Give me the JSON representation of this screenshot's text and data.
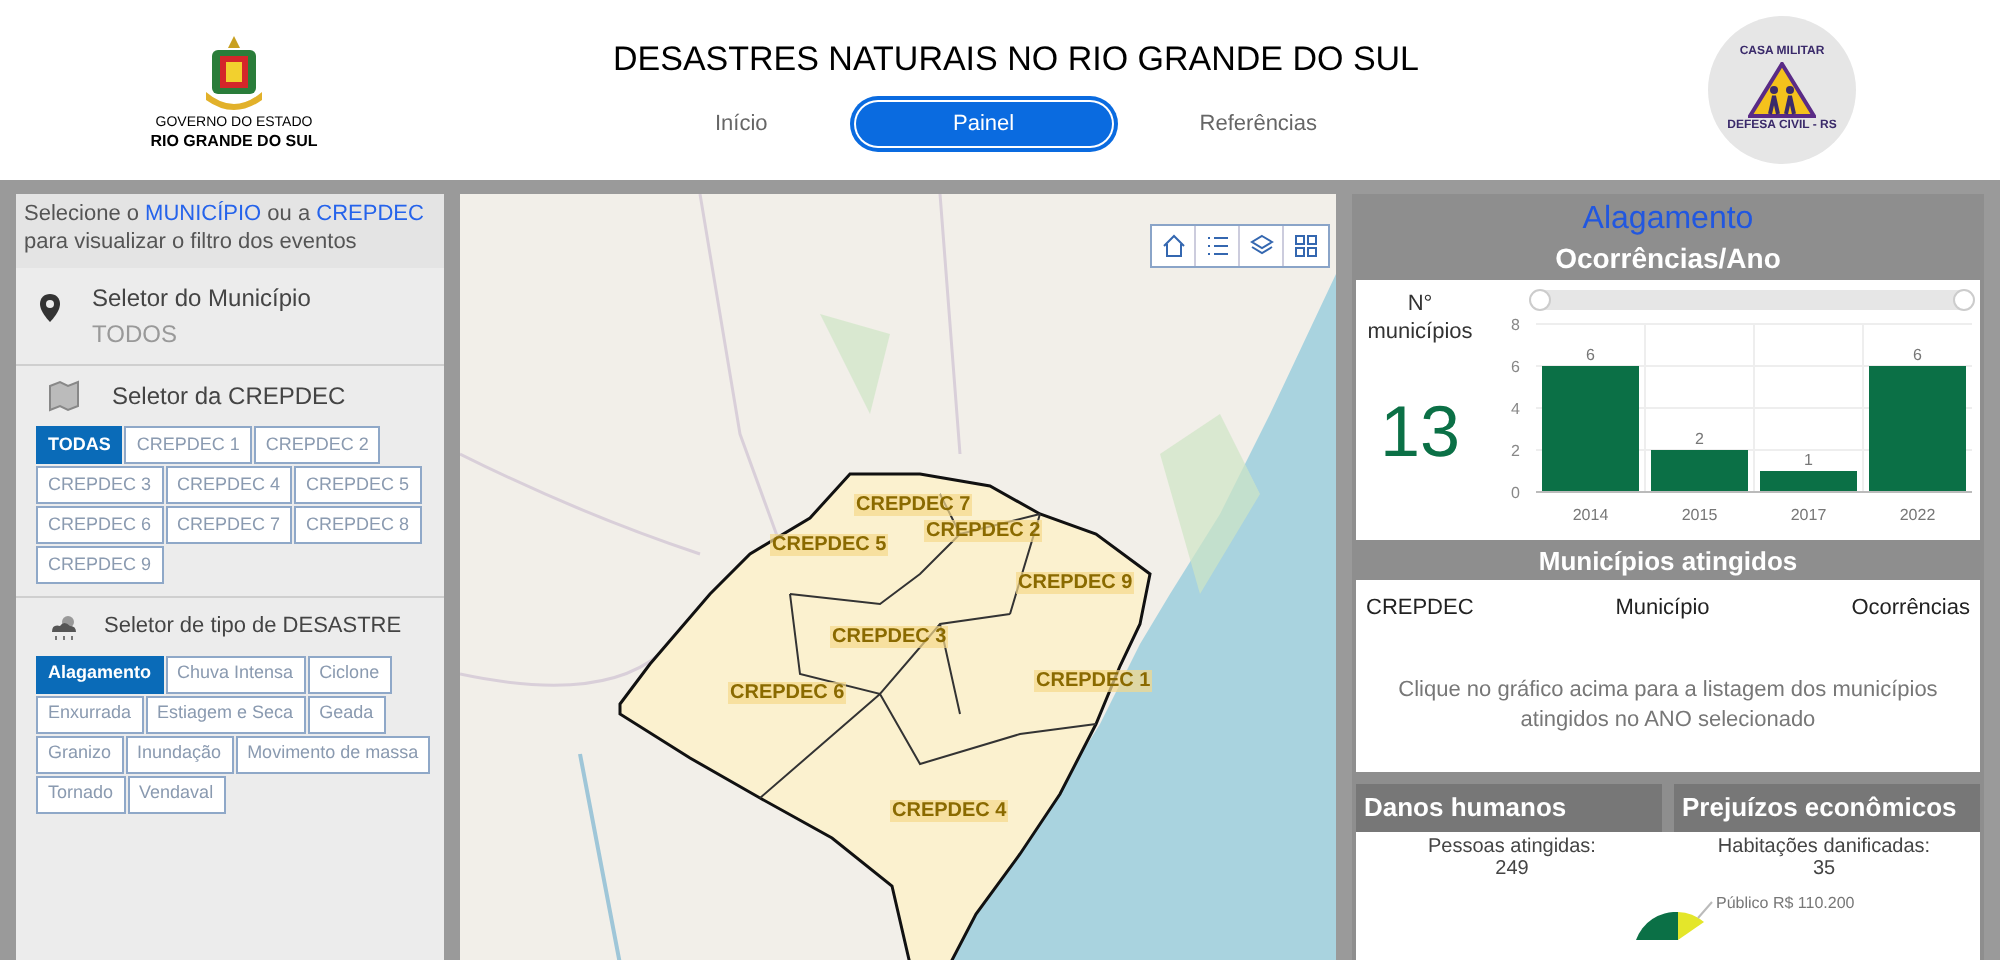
{
  "header": {
    "logo_left_text": [
      "GOVERNO DO ESTADO",
      "RIO GRANDE DO SUL"
    ],
    "title": "DESASTRES NATURAIS NO RIO GRANDE DO SUL",
    "logo_right_text": [
      "CASA MILITAR",
      "DEFESA CIVIL - RS"
    ]
  },
  "nav_tabs": [
    {
      "label": "Início",
      "selected": false
    },
    {
      "label": "Painel",
      "selected": true
    },
    {
      "label": "Referências",
      "selected": false
    }
  ],
  "sidebar": {
    "intro": "Selecione o **MUNICÍPIO** ou a **CREPDEC** para visualizar o filtro dos eventos",
    "municipality_selector": {
      "label": "Seletor do Município",
      "value": "TODOS"
    },
    "crepdec_selector": {
      "label": "Seletor da CREPDEC",
      "options": [
        {
          "label": "TODAS",
          "selected": true
        },
        {
          "label": "CREPDEC 1",
          "selected": false
        },
        {
          "label": "CREPDEC 2",
          "selected": false
        },
        {
          "label": "CREPDEC 3",
          "selected": false
        },
        {
          "label": "CREPDEC 4",
          "selected": false
        },
        {
          "label": "CREPDEC 5",
          "selected": false
        },
        {
          "label": "CREPDEC 6",
          "selected": false
        },
        {
          "label": "CREPDEC 7",
          "selected": false
        },
        {
          "label": "CREPDEC 8",
          "selected": false
        },
        {
          "label": "CREPDEC 9",
          "selected": false
        }
      ]
    },
    "disaster_selector": {
      "label": "Seletor de tipo de DESASTRE",
      "options": [
        {
          "label": "Alagamento",
          "selected": true
        },
        {
          "label": "Chuva Intensa",
          "selected": false
        },
        {
          "label": "Ciclone",
          "selected": false
        },
        {
          "label": "Enxurrada",
          "selected": false
        },
        {
          "label": "Estiagem e Seca",
          "selected": false
        },
        {
          "label": "Geada",
          "selected": false
        },
        {
          "label": "Granizo",
          "selected": false
        },
        {
          "label": "Inundação",
          "selected": false
        },
        {
          "label": "Movimento de massa",
          "selected": false
        },
        {
          "label": "Tornado",
          "selected": false
        },
        {
          "label": "Vendaval",
          "selected": false
        }
      ]
    }
  },
  "map": {
    "region_labels": [
      "CREPDEC 7",
      "CREPDEC 2",
      "CREPDEC 5",
      "CREPDEC 9",
      "CREPDEC 3",
      "CREPDEC 1",
      "CREPDEC 6",
      "CREPDEC 4"
    ]
  },
  "dashboard": {
    "disaster_title": "Alagamento",
    "occurrences_title": "Ocorrências/Ano",
    "municipalities_count": {
      "label": "N° municípios",
      "value": "13"
    },
    "chart_data": {
      "type": "bar",
      "categories": [
        "2014",
        "2015",
        "2017",
        "2022"
      ],
      "values": [
        6,
        2,
        1,
        6
      ],
      "ylim": [
        0,
        8
      ],
      "yticks": [
        0,
        2,
        4,
        6,
        8
      ],
      "data_labels": true,
      "grid": true
    },
    "affected_title": "Municípios atingidos",
    "columns": [
      "CREPDEC",
      "Município",
      "Ocorrências"
    ],
    "empty_message": "Clique no gráfico acima para a listagem dos municípios atingidos no ANO selecionado",
    "human_damage": {
      "title": "Danos humanos",
      "label": "Pessoas atingidas:",
      "value": "249"
    },
    "economic_losses": {
      "title": "Prejuízos econômicos",
      "label": "Habitações danificadas:",
      "value": "35",
      "pie_label": "Público R$ 110.200"
    }
  }
}
